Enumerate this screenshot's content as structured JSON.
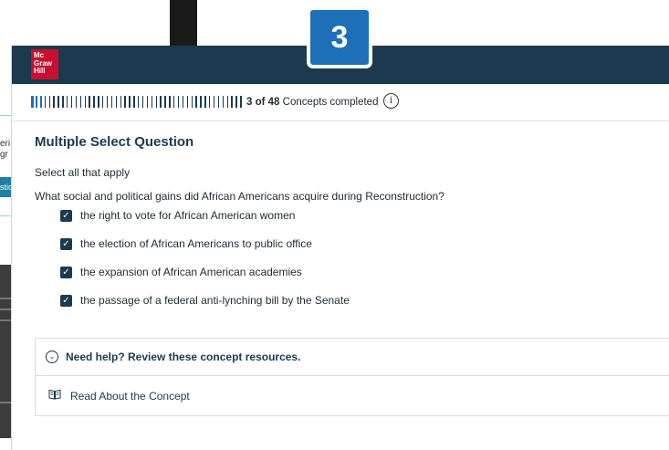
{
  "background": {
    "left_fragments": [
      "eri",
      "gr",
      "stic"
    ]
  },
  "step_badge": {
    "number": "3"
  },
  "header": {
    "logo_lines": [
      "Mc",
      "Graw",
      "Hill"
    ],
    "brand_color": "#c8102e",
    "bar_color": "#1c3a4f"
  },
  "progress": {
    "completed_bold": "3 of 48",
    "completed_suffix": " Concepts completed",
    "completed": 3,
    "total": 48,
    "info_glyph": "i"
  },
  "question": {
    "type_title": "Multiple Select Question",
    "instruction": "Select all that apply",
    "prompt": "What social and political gains did African Americans acquire during Reconstruction?",
    "options": [
      {
        "label": "the right to vote for African American women",
        "checked": true
      },
      {
        "label": "the election of African Americans to public office",
        "checked": true
      },
      {
        "label": "the expansion of African American academies",
        "checked": true
      },
      {
        "label": "the passage of a federal anti-lynching bill by the Senate",
        "checked": true
      }
    ]
  },
  "help": {
    "toggle_label": "Need help? Review these concept resources.",
    "resource_link": "Read About the Concept"
  },
  "icons": {
    "info": "info-icon",
    "checkbox": "checkbox-checked-icon",
    "chevron": "chevron-down-circle-icon",
    "book": "book-icon"
  }
}
